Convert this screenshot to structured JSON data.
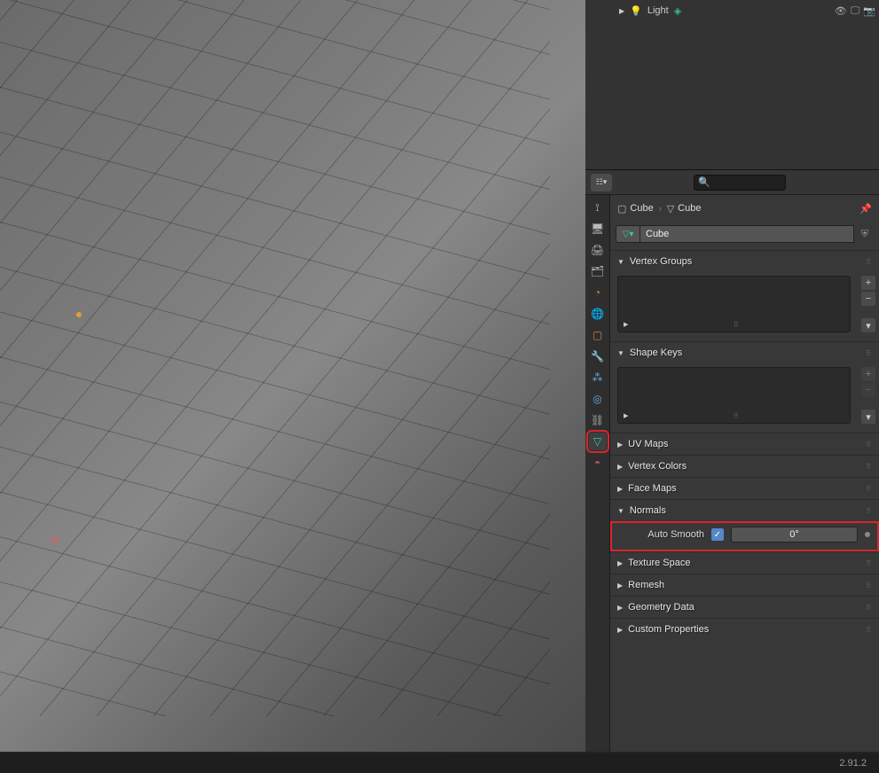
{
  "outliner": {
    "light_item": "Light",
    "icons": {
      "lamp": "💡",
      "data": "◈",
      "eye": "👁",
      "monitor": "🖵",
      "camera": "📷"
    }
  },
  "properties": {
    "search_placeholder": "",
    "breadcrumb": {
      "obj_icon": "▢",
      "obj": "Cube",
      "data_icon": "▽",
      "data": "Cube"
    },
    "datablock": {
      "icon": "▽▾",
      "name": "Cube"
    },
    "tabs": [
      "tool",
      "render",
      "output",
      "viewlayer",
      "scene",
      "world",
      "object",
      "modifier",
      "particle",
      "physics",
      "constraint",
      "mesh",
      "material"
    ],
    "active_tab": "mesh",
    "panels": {
      "vertex_groups": {
        "label": "Vertex Groups",
        "expanded": true
      },
      "shape_keys": {
        "label": "Shape Keys",
        "expanded": true
      },
      "uv_maps": {
        "label": "UV Maps",
        "expanded": false
      },
      "vertex_colors": {
        "label": "Vertex Colors",
        "expanded": false
      },
      "face_maps": {
        "label": "Face Maps",
        "expanded": false
      },
      "normals": {
        "label": "Normals",
        "expanded": true,
        "auto_smooth_label": "Auto Smooth",
        "auto_smooth_checked": true,
        "angle_value": "0°"
      },
      "texture_space": {
        "label": "Texture Space",
        "expanded": false
      },
      "remesh": {
        "label": "Remesh",
        "expanded": false
      },
      "geometry_data": {
        "label": "Geometry Data",
        "expanded": false
      },
      "custom_properties": {
        "label": "Custom Properties",
        "expanded": false
      }
    }
  },
  "statusbar": {
    "version": "2.91.2"
  }
}
